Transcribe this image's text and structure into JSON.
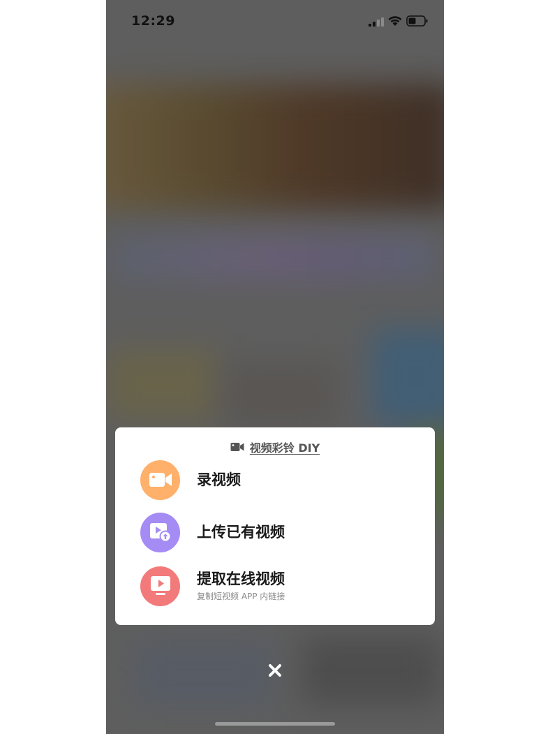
{
  "status_bar": {
    "time": "12:29",
    "signal_icon": "cellular-signal-icon",
    "wifi_icon": "wifi-icon",
    "battery_icon": "battery-icon"
  },
  "sheet": {
    "header": {
      "icon": "video-icon",
      "title": "视频彩铃 DIY"
    },
    "options": [
      {
        "label": "录视频",
        "icon": "video-camera-icon",
        "color": "#FFB06B"
      },
      {
        "label": "上传已有视频",
        "icon": "upload-video-icon",
        "color": "#A58CF5"
      },
      {
        "label": "提取在线视频",
        "sublabel": "复制短视频 APP 内链接",
        "icon": "tv-play-icon",
        "color": "#F27A7A"
      }
    ]
  },
  "close_icon": "close-icon",
  "colors": {
    "overlay": "#5E5E5E",
    "sheet_background": "#FFFFFF"
  }
}
